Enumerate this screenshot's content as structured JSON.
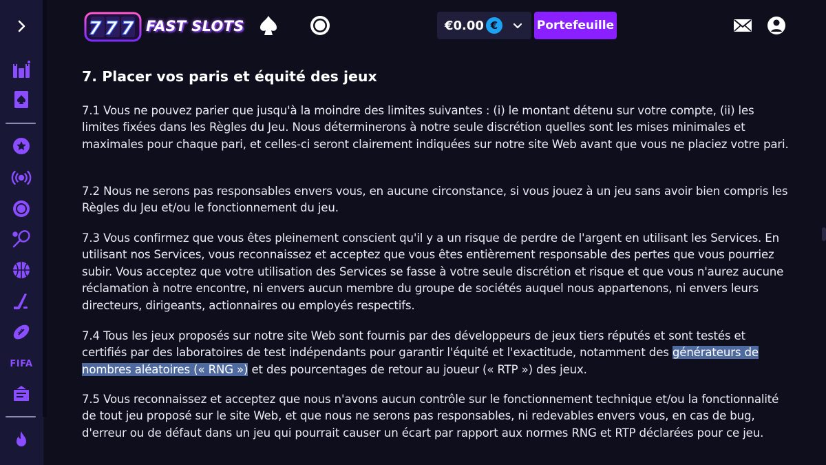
{
  "brand": {
    "name": "FAST SLOTS",
    "reels": "777"
  },
  "header": {
    "balance": "€0.00",
    "currency_symbol": "€",
    "wallet_button": "Portefeuille"
  },
  "sidebar": {
    "fifa_label": "FIFA"
  },
  "section": {
    "title": "7. Placer vos paris et équité des jeux",
    "p1": "7.1 Vous ne pouvez parier que jusqu'à la moindre des limites suivantes : (i) le montant détenu sur votre compte, (ii) les limites fixées dans les Règles du Jeu. Nous déterminerons à notre seule discrétion quelles sont les mises minimales et maximales pour chaque pari, et celles-ci seront clairement indiquées sur notre site Web avant que vous ne placiez votre pari.",
    "p2": "7.2 Nous ne serons pas responsables envers vous, en aucune circonstance, si vous jouez à un jeu sans avoir bien compris les Règles du Jeu et/ou le fonctionnement du jeu.",
    "p3": "7.3 Vous confirmez que vous êtes pleinement conscient qu'il y a un risque de perdre de l'argent en utilisant les Services. En utilisant nos Services, vous reconnaissez et acceptez que vous êtes entièrement responsable des pertes que vous pourriez subir. Vous acceptez que votre utilisation des Services se fasse à votre seule discrétion et risque et que vous n'aurez aucune réclamation à notre encontre, ni envers aucun membre du groupe de sociétés auquel nous appartenons, ni envers leurs directeurs, dirigeants, actionnaires ou employés respectifs.",
    "p4_before": "7.4 Tous les jeux proposés sur notre site Web sont fournis par des développeurs de jeux tiers réputés et sont testés et certifiés par des laboratoires de test indépendants pour garantir l'équité et l'exactitude, notamment des ",
    "p4_highlight": "générateurs de nombres aléatoires (« RNG »)",
    "p4_after": " et des pourcentages de retour au joueur (« RTP ») des jeux.",
    "p5": "7.5 Vous reconnaissez et acceptez que nous n'avons aucun contrôle sur le fonctionnement technique et/ou la fonctionnalité de tout jeu proposé sur le site Web, et que nous ne serons pas responsables, ni redevables envers vous, en cas de bug, d'erreur ou de défaut dans un jeu qui pourrait causer un écart par rapport aux normes RNG et RTP déclarées pour ce jeu."
  },
  "colors": {
    "accent": "#8a1fff",
    "sidebar_icon": "#8a4dff",
    "highlight": "#4e6a9f",
    "background": "#0f0e1d"
  },
  "icons": [
    "chevron-right-icon",
    "castle-icon",
    "cards-icon",
    "star-badge-icon",
    "live-broadcast-icon",
    "soccer-ball-icon",
    "tennis-icon",
    "basketball-icon",
    "hockey-stick-icon",
    "american-football-icon",
    "ticket-icon",
    "flame-icon",
    "spade-icon",
    "soccer-header-icon",
    "chevron-down-icon",
    "mail-icon",
    "user-icon"
  ]
}
